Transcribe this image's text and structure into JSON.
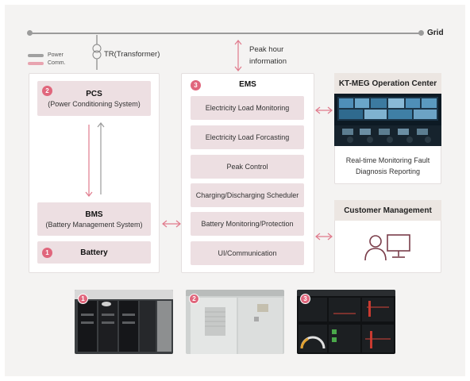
{
  "grid": {
    "label": "Grid"
  },
  "legend": {
    "power": "Power",
    "comm": "Comm.",
    "power_color": "#a0a0a0",
    "comm_color": "#e8a4b0"
  },
  "transformer": {
    "label": "TR(Transformer)",
    "icon": "transformer-icon"
  },
  "peak": {
    "line1": "Peak hour",
    "line2": "information"
  },
  "left_panel": {
    "pcs": {
      "number": "2",
      "title": "PCS",
      "subtitle": "(Power Conditioning System)"
    },
    "bms": {
      "title": "BMS",
      "subtitle": "(Battery Management System)"
    },
    "battery": {
      "number": "1",
      "title": "Battery"
    }
  },
  "ems": {
    "number": "3",
    "title": "EMS",
    "items": [
      "Electricity Load Monitoring",
      "Electricity Load Forcasting",
      "Peak Control",
      "Charging/Discharging Scheduler",
      "Battery Monitoring/Protection",
      "UI/Communication"
    ]
  },
  "operation_center": {
    "title": "KT-MEG Operation Center",
    "caption_line1": "Real-time Monitoring Fault",
    "caption_line2": "Diagnosis Reporting"
  },
  "customer": {
    "title": "Customer Management",
    "icon": "user-computer-icon"
  },
  "photos": [
    {
      "number": "1",
      "subject": "battery-rack-photo"
    },
    {
      "number": "2",
      "subject": "pcs-cabinet-photo"
    },
    {
      "number": "3",
      "subject": "ems-dashboard-photo"
    }
  ],
  "colors": {
    "accent": "#e0667c",
    "pill": "#eddfe2",
    "arrow": "#e07a8c",
    "power_arrow": "#9b9b9b"
  }
}
